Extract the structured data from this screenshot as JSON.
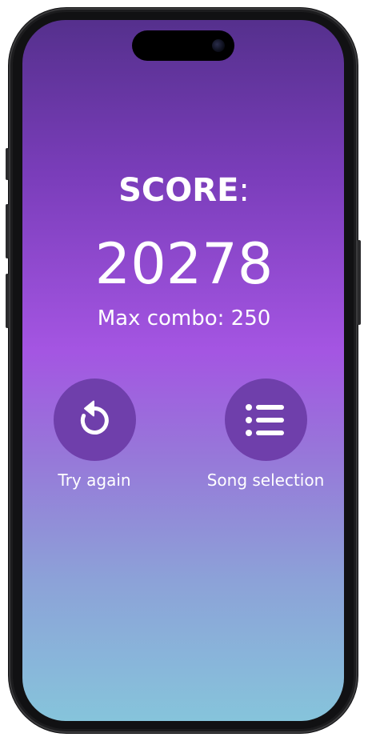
{
  "score": {
    "title": "SCORE",
    "title_suffix": ":",
    "value": "20278",
    "combo_text": "Max combo: 250"
  },
  "actions": {
    "retry": {
      "label": "Try again",
      "icon": "retry-icon"
    },
    "songs": {
      "label": "Song selection",
      "icon": "list-icon"
    }
  },
  "colors": {
    "gradient_top": "#55308d",
    "gradient_mid": "#a455e2",
    "gradient_bottom": "#86c4db",
    "button_fill": "#6f3fab",
    "text": "#ffffff"
  }
}
